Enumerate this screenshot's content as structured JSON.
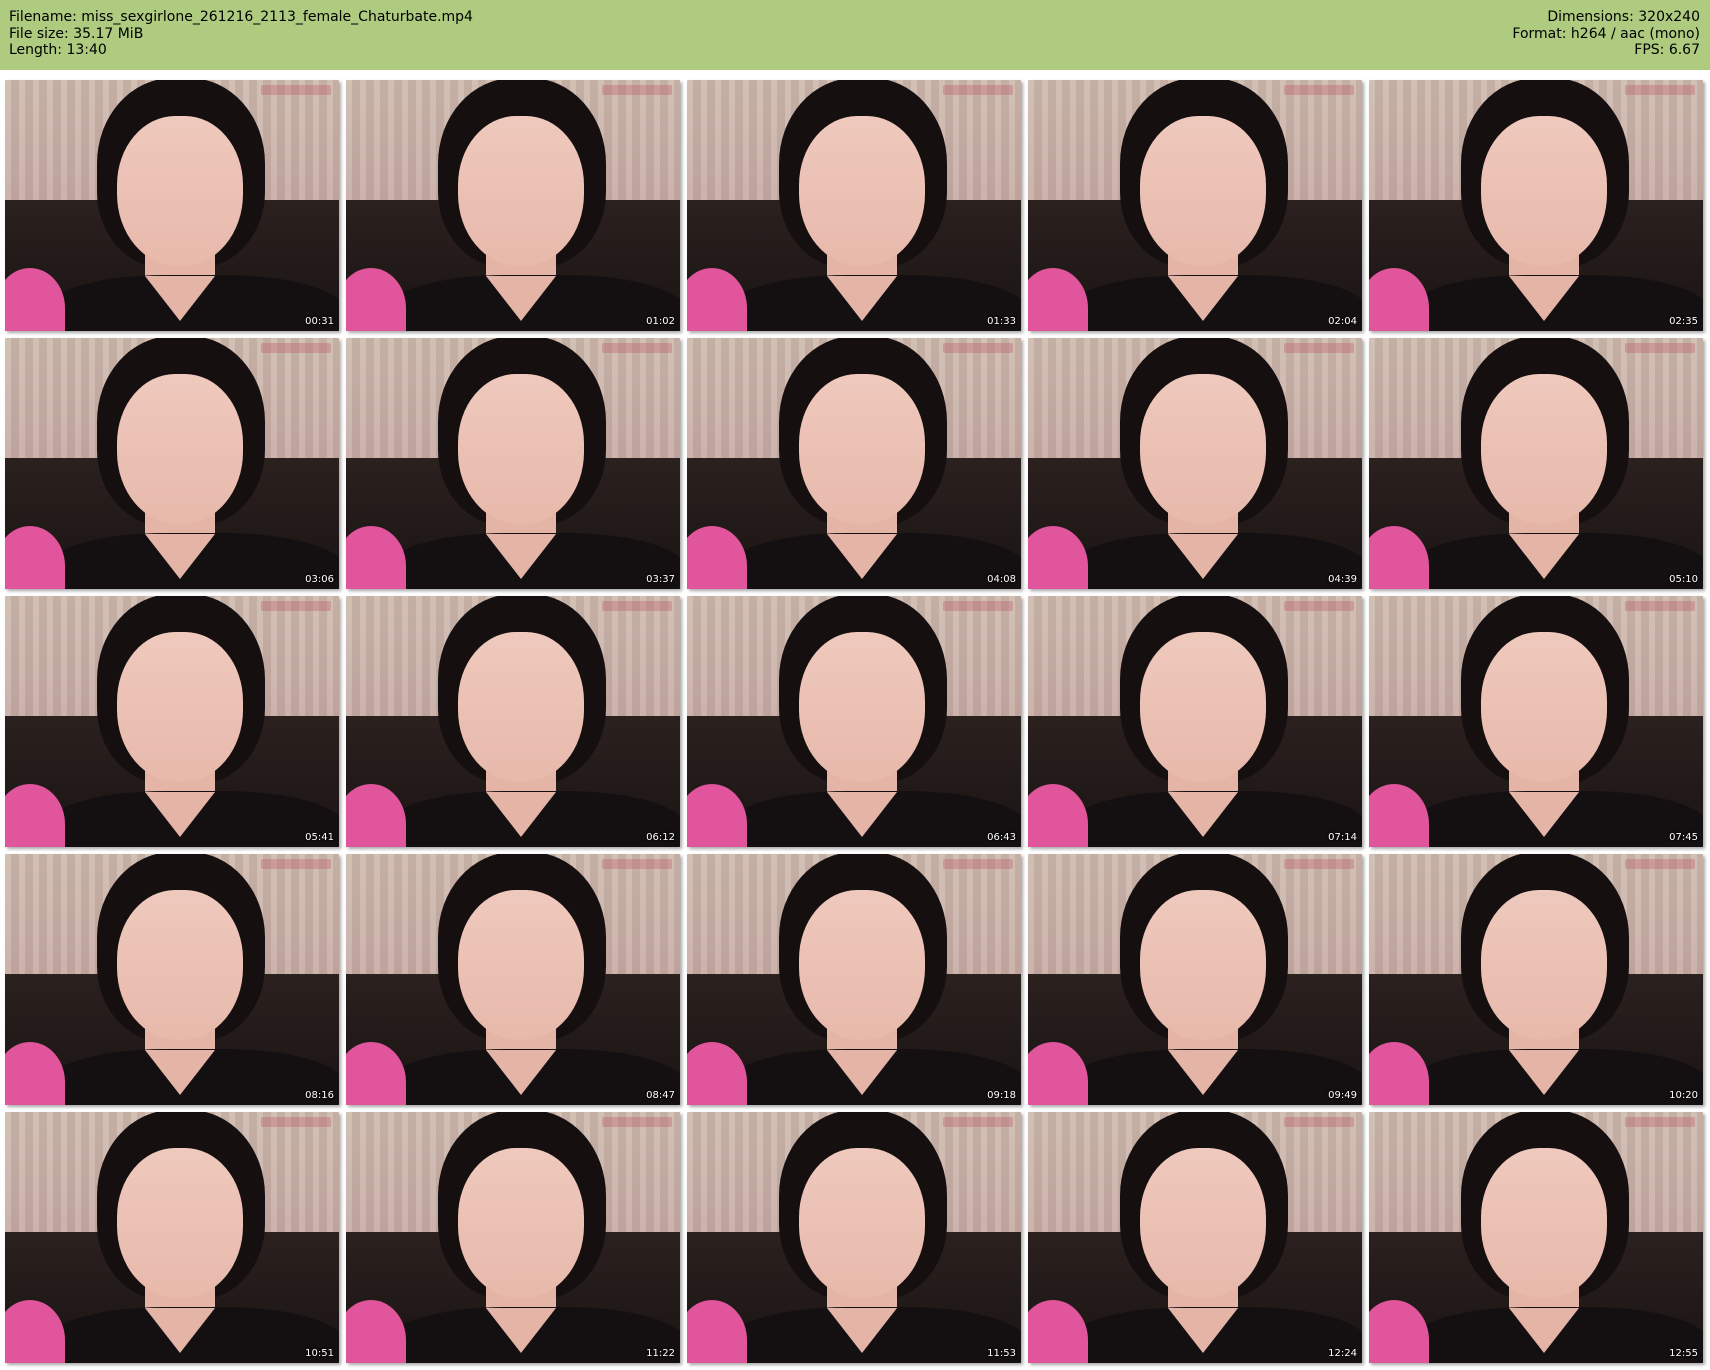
{
  "header": {
    "filename": "Filename: miss_sexgirlone_261216_2113_female_Chaturbate.mp4",
    "file_size": "File size: 35.17 MiB",
    "length": "Length: 13:40",
    "dimensions": "Dimensions: 320x240",
    "format": "Format: h264 / aac (mono)",
    "fps": "FPS: 6.67"
  },
  "thumbnails": [
    "00:31",
    "01:02",
    "01:33",
    "02:04",
    "02:35",
    "03:06",
    "03:37",
    "04:08",
    "04:39",
    "05:10",
    "05:41",
    "06:12",
    "06:43",
    "07:14",
    "07:45",
    "08:16",
    "08:47",
    "09:18",
    "09:49",
    "10:20",
    "10:51",
    "11:22",
    "11:53",
    "12:24",
    "12:55"
  ],
  "colors": {
    "header_bg": "#aecb80",
    "page_bg": "#ffffff"
  }
}
